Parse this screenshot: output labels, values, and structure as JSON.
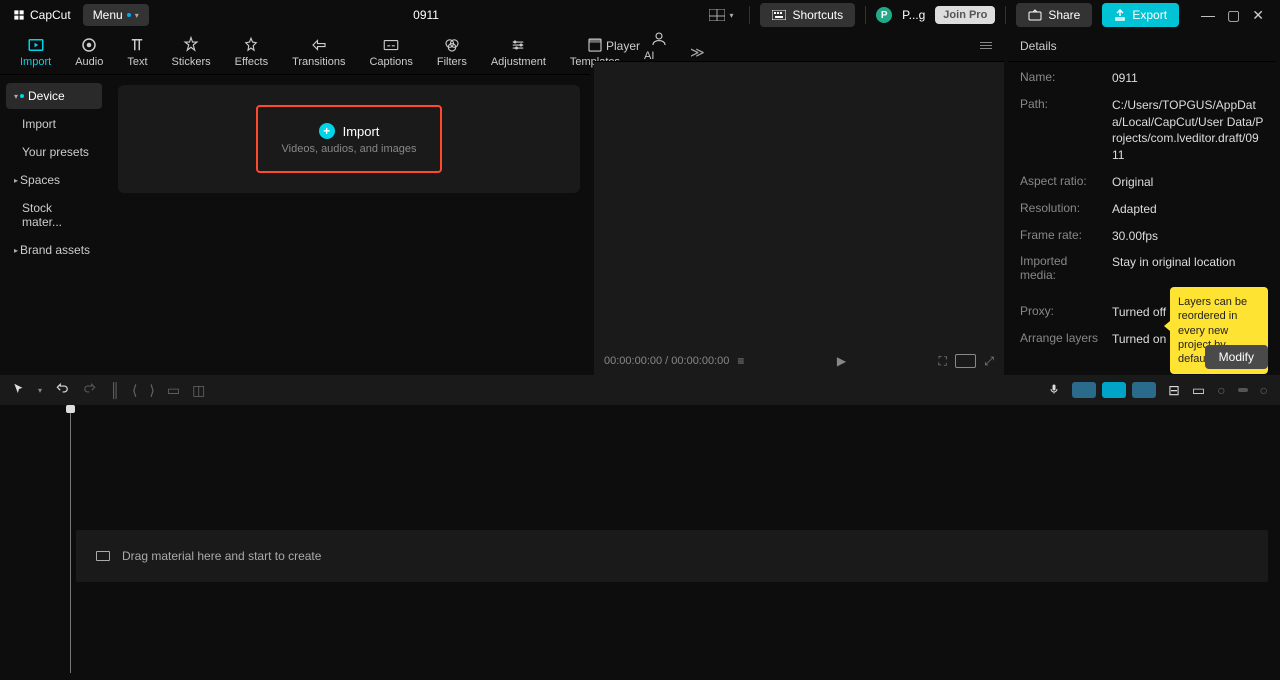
{
  "app_name": "CapCut",
  "menu_label": "Menu",
  "project_title": "0911",
  "shortcuts_label": "Shortcuts",
  "user_short": "P...g",
  "join_pro": "Join Pro",
  "share_label": "Share",
  "export_label": "Export",
  "top_tabs": [
    "Import",
    "Audio",
    "Text",
    "Stickers",
    "Effects",
    "Transitions",
    "Captions",
    "Filters",
    "Adjustment",
    "Templates",
    "AI Chara"
  ],
  "sidebar": {
    "device": "Device",
    "import": "Import",
    "presets": "Your presets",
    "spaces": "Spaces",
    "stock": "Stock mater...",
    "brand": "Brand assets"
  },
  "import_box": {
    "title": "Import",
    "sub": "Videos, audios, and images"
  },
  "player": {
    "title": "Player",
    "time": "00:00:00:00 / 00:00:00:00"
  },
  "details": {
    "title": "Details",
    "name_label": "Name:",
    "name_value": "0911",
    "path_label": "Path:",
    "path_value": "C:/Users/TOPGUS/AppData/Local/CapCut/User Data/Projects/com.lveditor.draft/0911",
    "aspect_label": "Aspect ratio:",
    "aspect_value": "Original",
    "resolution_label": "Resolution:",
    "resolution_value": "Adapted",
    "framerate_label": "Frame rate:",
    "framerate_value": "30.00fps",
    "imported_label": "Imported media:",
    "imported_value": "Stay in original location",
    "proxy_label": "Proxy:",
    "proxy_value": "Turned off",
    "layers_label": "Arrange layers",
    "layers_value": "Turned on",
    "tooltip": "Layers can be reordered in every new project by default.",
    "modify": "Modify"
  },
  "timeline": {
    "drag_hint": "Drag material here and start to create"
  }
}
